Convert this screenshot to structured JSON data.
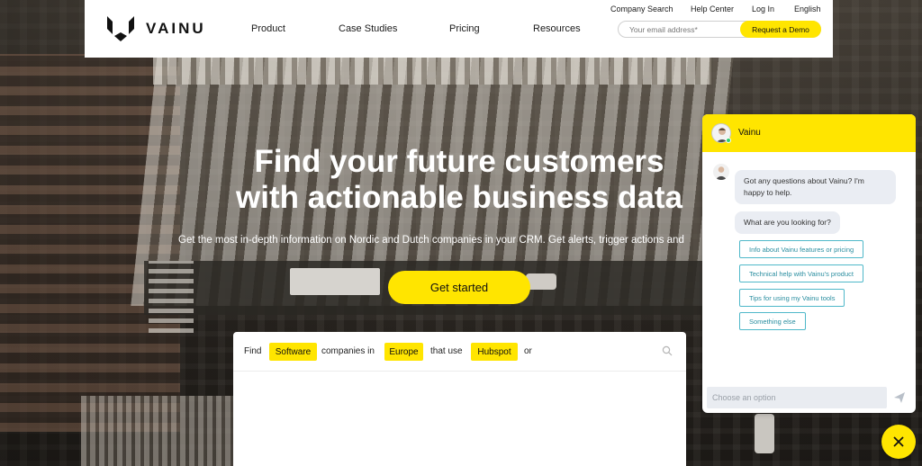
{
  "brand": {
    "name": "VAINU",
    "accent": "#ffe500"
  },
  "top_links": [
    "Company Search",
    "Help Center",
    "Log In",
    "English"
  ],
  "nav": [
    "Product",
    "Case Studies",
    "Pricing",
    "Resources"
  ],
  "email": {
    "placeholder": "Your email address*",
    "button": "Request a Demo"
  },
  "hero": {
    "title_line1": "Find your future customers",
    "title_line2": "with actionable business data",
    "subtitle": "Get the most in-depth information on Nordic and Dutch companies in your CRM. Get alerts, trigger actions and",
    "cta": "Get started"
  },
  "search": {
    "words": [
      "Find",
      "companies in",
      "that use",
      "or"
    ],
    "chips": [
      "Software",
      "Europe",
      "Hubspot"
    ]
  },
  "chat": {
    "name": "Vainu",
    "messages": [
      "Got any questions about Vainu? I'm happy to help.",
      "What are you looking for?"
    ],
    "options": [
      "Info about Vainu features or pricing",
      "Technical help with Vainu's product",
      "Tips for using my Vainu tools",
      "Something else"
    ],
    "input_placeholder": "Choose an option",
    "online_color": "#2ecc71",
    "option_color": "#4fb8c9"
  },
  "icons": [
    "vainu-logo-icon",
    "search-icon",
    "send-icon",
    "close-icon",
    "avatar"
  ]
}
